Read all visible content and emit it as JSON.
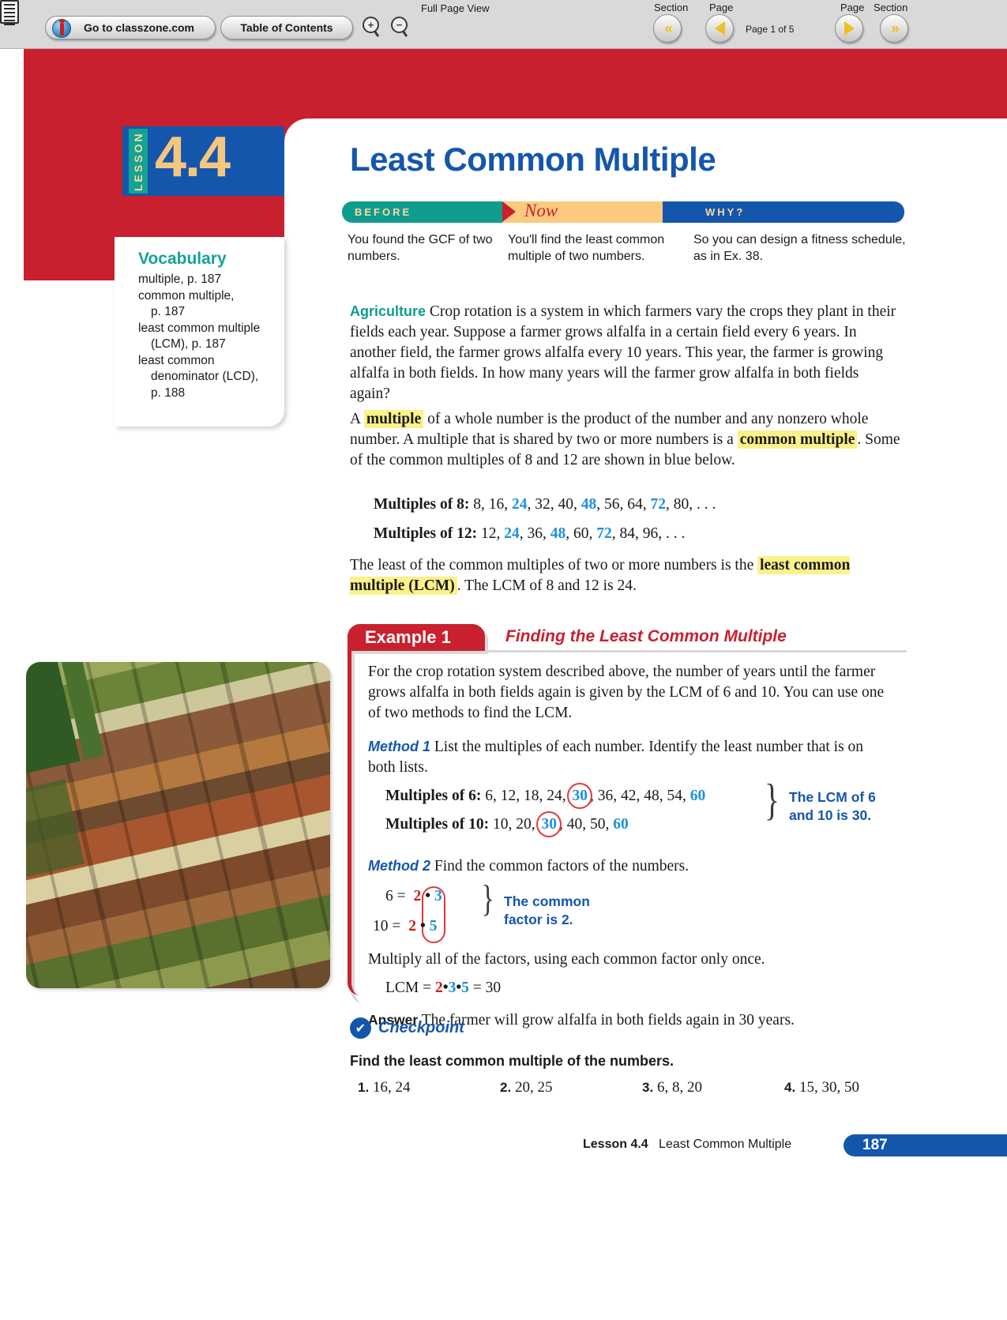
{
  "toolbar": {
    "classzone_label": "Go to classzone.com",
    "toc_label": "Table of Contents",
    "zoom_in_glyph": "+",
    "zoom_out_glyph": "−",
    "full_page_view_label": "Full Page View",
    "section_left_label": "Section",
    "page_left_label": "Page",
    "page_indicator": "Page 1 of 5",
    "page_right_label": "Page",
    "section_right_label": "Section",
    "section_prev_glyph": "«",
    "section_next_glyph": "»"
  },
  "lesson": {
    "lesson_word": "LESSON",
    "number": "4.4",
    "title": "Least Common Multiple"
  },
  "vocabulary": {
    "heading": "Vocabulary",
    "items": [
      {
        "text": "multiple, p. 187",
        "indent": false
      },
      {
        "text": "common multiple,",
        "indent": false
      },
      {
        "text": "p. 187",
        "indent": true
      },
      {
        "text": "least common multiple",
        "indent": false
      },
      {
        "text": "(LCM), p. 187",
        "indent": true
      },
      {
        "text": "least common",
        "indent": false
      },
      {
        "text": "denominator (LCD),",
        "indent": true
      },
      {
        "text": "p. 188",
        "indent": true
      }
    ]
  },
  "banner": {
    "before_label": "BEFORE",
    "now_label": "Now",
    "why_label": "WHY?",
    "before_text": "You found the GCF of two numbers.",
    "now_text": "You'll find the least common multiple of two numbers.",
    "why_text": "So you can design a fitness schedule, as in Ex. 38."
  },
  "intro": {
    "topic_label": "Agriculture",
    "paragraph": "Crop rotation is a system in which farmers vary the crops they plant in their fields each year. Suppose a farmer grows alfalfa in a certain field every 6 years. In another field, the farmer grows alfalfa every 10 years. This year, the farmer is growing alfalfa in both fields. In how many years will the farmer grow alfalfa in both fields again?"
  },
  "definitions": {
    "part1": "A ",
    "term1": "multiple",
    "part2": " of a whole number is the product of the number and any nonzero whole number. A multiple that is shared by two or more numbers is a ",
    "term2": "common multiple",
    "part3": ". Some of the common multiples of 8 and 12 are shown in blue below.",
    "least_part1": "The least of the common multiples of two or more numbers is the ",
    "term3": "least common multiple (LCM)",
    "least_part2": ". The LCM of 8 and 12 is 24."
  },
  "multiples_lists": [
    {
      "label": "Multiples of 8:",
      "tokens": [
        {
          "v": "8",
          "blue": false
        },
        {
          "v": "16",
          "blue": false
        },
        {
          "v": "24",
          "blue": true
        },
        {
          "v": "32",
          "blue": false
        },
        {
          "v": "40",
          "blue": false
        },
        {
          "v": "48",
          "blue": true
        },
        {
          "v": "56",
          "blue": false
        },
        {
          "v": "64",
          "blue": false
        },
        {
          "v": "72",
          "blue": true
        },
        {
          "v": "80",
          "blue": false
        }
      ],
      "ellipsis": ". . ."
    },
    {
      "label": "Multiples of 12:",
      "tokens": [
        {
          "v": "12",
          "blue": false
        },
        {
          "v": "24",
          "blue": true
        },
        {
          "v": "36",
          "blue": false
        },
        {
          "v": "48",
          "blue": true
        },
        {
          "v": "60",
          "blue": false
        },
        {
          "v": "72",
          "blue": true
        },
        {
          "v": "84",
          "blue": false
        },
        {
          "v": "96",
          "blue": false
        }
      ],
      "ellipsis": ". . ."
    }
  ],
  "example": {
    "tab_label": "Example 1",
    "title": "Finding the Least Common Multiple",
    "intro": "For the crop rotation system described above, the number of years until the farmer grows alfalfa in both fields again is given by the LCM of 6 and 10. You can use one of two methods to find the LCM.",
    "method1_label": "Method 1",
    "method1_text": "List the multiples of each number. Identify the least number that is on both lists.",
    "m6_label": "Multiples of 6:",
    "m6_values": "6, 12, 18, 24, 30, 36, 42, 48, 54, 60",
    "m10_label": "Multiples of 10:",
    "m10_values": "10, 20, 30, 40, 50, 60",
    "lcm_callout_line1": "The LCM of 6",
    "lcm_callout_line2": "and 10 is 30.",
    "method2_label": "Method 2",
    "method2_text": "Find the common factors of the numbers.",
    "fact6": {
      "left": "6 =",
      "common": "2",
      "dot": "•",
      "other": "3"
    },
    "fact10": {
      "left": "10 =",
      "common": "2",
      "dot": "•",
      "other": "5"
    },
    "factor_callout_line1": "The common",
    "factor_callout_line2": "factor is 2.",
    "multiply_text": "Multiply all of the factors, using each common factor only once.",
    "lcm_equation": {
      "lhs": "LCM =",
      "f1": "2",
      "d1": "•",
      "f2": "3",
      "d2": "•",
      "f3": "5",
      "eq": "=",
      "result": "30"
    },
    "answer_label": "Answer",
    "answer_text": "The farmer will grow alfalfa in both fields again in 30 years."
  },
  "checkpoint": {
    "badge_glyph": "✔",
    "label": "Checkpoint",
    "instruction": "Find the least common multiple of the numbers.",
    "exercises": [
      {
        "num": "1.",
        "text": "16, 24"
      },
      {
        "num": "2.",
        "text": "20, 25"
      },
      {
        "num": "3.",
        "text": "6, 8, 20"
      },
      {
        "num": "4.",
        "text": "15, 30, 50"
      }
    ]
  },
  "footer": {
    "lesson_label": "Lesson 4.4",
    "lesson_title": "Least Common Multiple",
    "page_number": "187"
  },
  "photo": {
    "caption_alt": "aerial-view-of-crop-fields"
  },
  "colors": {
    "red": "#c8202e",
    "blue": "#1556ad",
    "teal": "#0f9c8d",
    "gold": "#f5c77e",
    "highlight": "#fbf28a",
    "light_blue": "#1e8fe0"
  }
}
